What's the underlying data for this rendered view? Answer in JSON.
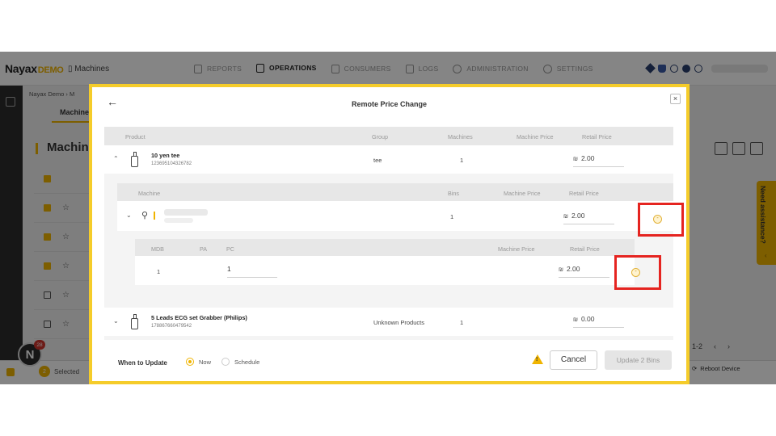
{
  "brand": {
    "name": "Nayax",
    "demo": "DEMO",
    "app": "Machines"
  },
  "nav": [
    {
      "label": "REPORTS",
      "icon": "report-icon"
    },
    {
      "label": "OPERATIONS",
      "icon": "operations-icon",
      "active": true
    },
    {
      "label": "CONSUMERS",
      "icon": "consumers-icon"
    },
    {
      "label": "LOGS",
      "icon": "logs-icon"
    },
    {
      "label": "ADMINISTRATION",
      "icon": "administration-icon"
    },
    {
      "label": "SETTINGS",
      "icon": "settings-icon"
    }
  ],
  "background": {
    "breadcrumb": "Nayax Demo  ›  M",
    "tab": "Machine",
    "title": "Machine",
    "selected_count": "2",
    "selected_label": "Selected",
    "reboot_label": "Reboot Device",
    "notification_count": "28",
    "assistance_label": "Need assistance?",
    "pager": [
      "1-2",
      "‹",
      "›"
    ]
  },
  "modal": {
    "title": "Remote Price Change",
    "close": "×",
    "back": "←",
    "columns": {
      "product": "Product",
      "group": "Group",
      "machines": "Machines",
      "machine_price": "Machine Price",
      "retail_price": "Retail Price"
    },
    "products": [
      {
        "name": "10 yen tee",
        "code": "123695104326782",
        "group": "tee",
        "machines": "1",
        "currency": "₪",
        "retail_price": "2.00",
        "expanded": true
      },
      {
        "name": "5 Leads ECG set Grabber (Philips)",
        "code": "178867660479542",
        "group": "Unknown Products",
        "machines": "1",
        "currency": "₪",
        "retail_price": "0.00",
        "expanded": false
      }
    ],
    "machine_columns": {
      "machine": "Machine",
      "bins": "Bins",
      "machine_price": "Machine Price",
      "retail_price": "Retail Price"
    },
    "machine_row": {
      "bins": "1",
      "currency": "₪",
      "retail_price": "2.00"
    },
    "bin_columns": {
      "mdb": "MDB",
      "pa": "PA",
      "pc": "PC",
      "machine_price": "Machine Price",
      "retail_price": "Retail Price"
    },
    "bin_row": {
      "mdb": "1",
      "pc": "1",
      "currency": "₪",
      "retail_price": "2.00"
    },
    "reset_symbol": "-",
    "when_to_update": "When to Update",
    "options": [
      "Now",
      "Schedule"
    ],
    "selected_option": "Now",
    "warning_symbol": "!",
    "cancel": "Cancel",
    "update": "Update 2 Bins"
  },
  "colors": {
    "accent": "#f0b400",
    "highlight": "#e52420",
    "modal_border": "#f5cc2a"
  }
}
